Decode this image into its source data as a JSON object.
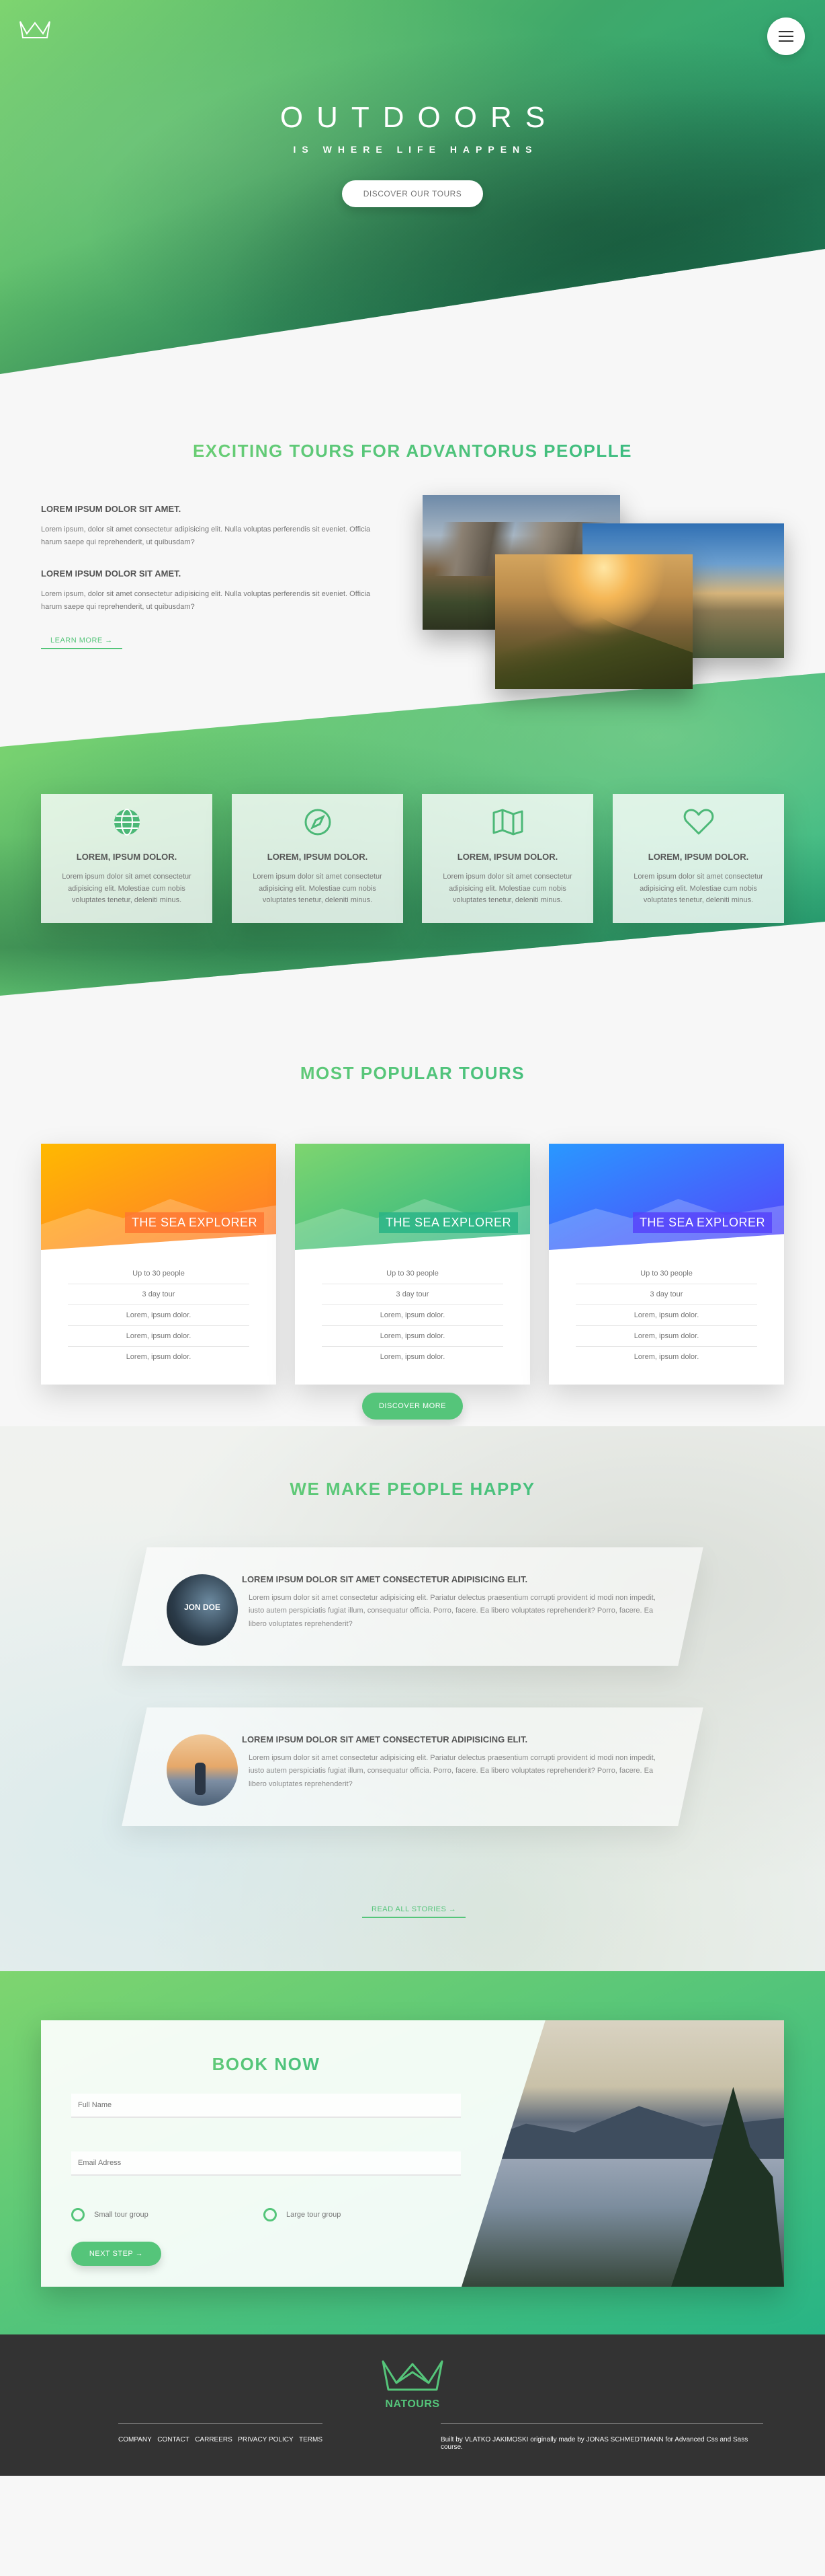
{
  "header": {
    "title": "OUTDOORS",
    "subtitle": "IS WHERE LIFE HAPPENS",
    "cta": "DISCOVER OUR TOURS"
  },
  "about": {
    "heading": "EXCITING TOURS FOR ADVANTORUS PEOPLLE",
    "blocks": [
      {
        "title": "LOREM IPSUM DOLOR SIT AMET.",
        "text": "Lorem ipsum, dolor sit amet consectetur adipisicing elit. Nulla voluptas perferendis sit eveniet. Officia harum saepe qui reprehenderit, ut quibusdam?"
      },
      {
        "title": "LOREM IPSUM DOLOR SIT AMET.",
        "text": "Lorem ipsum, dolor sit amet consectetur adipisicing elit. Nulla voluptas perferendis sit eveniet. Officia harum saepe qui reprehenderit, ut quibusdam?"
      }
    ],
    "link": "LEARN MORE →"
  },
  "features": [
    {
      "icon": "globe-icon",
      "title": "LOREM, IPSUM DOLOR.",
      "text": "Lorem ipsum dolor sit amet consectetur adipisicing elit. Molestiae cum nobis voluptates tenetur, deleniti minus."
    },
    {
      "icon": "compass-icon",
      "title": "LOREM, IPSUM DOLOR.",
      "text": "Lorem ipsum dolor sit amet consectetur adipisicing elit. Molestiae cum nobis voluptates tenetur, deleniti minus."
    },
    {
      "icon": "map-icon",
      "title": "LOREM, IPSUM DOLOR.",
      "text": "Lorem ipsum dolor sit amet consectetur adipisicing elit. Molestiae cum nobis voluptates tenetur, deleniti minus."
    },
    {
      "icon": "heart-icon",
      "title": "LOREM, IPSUM DOLOR.",
      "text": "Lorem ipsum dolor sit amet consectetur adipisicing elit. Molestiae cum nobis voluptates tenetur, deleniti minus."
    }
  ],
  "tours": {
    "heading": "MOST POPULAR TOURS",
    "cards": [
      {
        "title": "THE SEA EXPLORER",
        "theme": "orange",
        "details": [
          "Up to 30 people",
          "3 day tour",
          "Lorem, ipsum dolor.",
          "Lorem, ipsum dolor.",
          "Lorem, ipsum dolor."
        ]
      },
      {
        "title": "THE SEA EXPLORER",
        "theme": "green",
        "details": [
          "Up to 30 people",
          "3 day tour",
          "Lorem, ipsum dolor.",
          "Lorem, ipsum dolor.",
          "Lorem, ipsum dolor."
        ]
      },
      {
        "title": "THE SEA EXPLORER",
        "theme": "blue",
        "details": [
          "Up to 30 people",
          "3 day tour",
          "Lorem, ipsum dolor.",
          "Lorem, ipsum dolor.",
          "Lorem, ipsum dolor."
        ]
      }
    ],
    "cta": "DISCOVER MORE"
  },
  "stories": {
    "heading": "WE MAKE PEOPLE HAPPY",
    "items": [
      {
        "avatar_label": "JON DOE",
        "title": "LOREM IPSUM DOLOR SIT AMET CONSECTETUR ADIPISICING ELIT.",
        "text": "Lorem ipsum dolor sit amet consectetur adipisicing elit. Pariatur delectus praesentium corrupti provident id modi non impedit, iusto autem perspiciatis fugiat illum, consequatur officia. Porro, facere. Ea libero voluptates reprehenderit? Porro, facere. Ea libero voluptates reprehenderit?"
      },
      {
        "avatar_label": "",
        "title": "LOREM IPSUM DOLOR SIT AMET CONSECTETUR ADIPISICING ELIT.",
        "text": "Lorem ipsum dolor sit amet consectetur adipisicing elit. Pariatur delectus praesentium corrupti provident id modi non impedit, iusto autem perspiciatis fugiat illum, consequatur officia. Porro, facere. Ea libero voluptates reprehenderit? Porro, facere. Ea libero voluptates reprehenderit?"
      }
    ],
    "link": "READ ALL STORIES →"
  },
  "booking": {
    "heading": "BOOK NOW",
    "name_placeholder": "Full Name",
    "email_placeholder": "Email Adress",
    "options": [
      "Small tour group",
      "Large tour group"
    ],
    "next": "NEXT STEP →"
  },
  "footer": {
    "brand": "NATOURS",
    "nav": [
      "COMPANY",
      "CONTACT",
      "CARREERS",
      "PRIVACY POLICY",
      "TERMS"
    ],
    "copyright": "Built by VLATKO JAKIMOSKI originally made by JONAS SCHMEDTMANN for Advanced Css and Sass course."
  },
  "colors": {
    "primary": "#55c57a",
    "primary_light": "#7ed56f",
    "primary_dark": "#28b485",
    "orange": "#ff7730",
    "blue": "#5643fa",
    "footer_bg": "#333333"
  }
}
